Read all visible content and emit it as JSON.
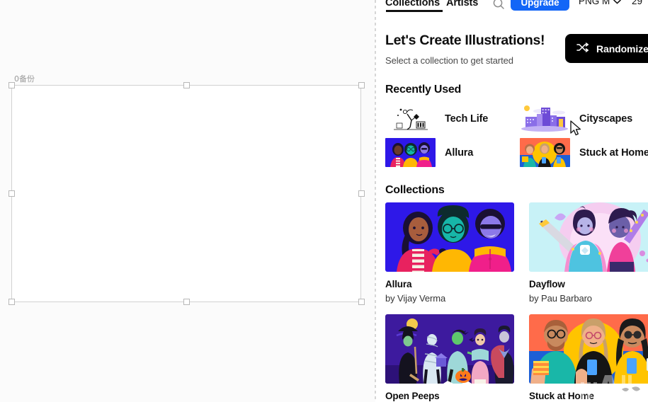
{
  "canvas": {
    "artboard_label": "0备份",
    "background_color": "#fbfbfb",
    "selection_border_color": "#d2d2d2"
  },
  "panel": {
    "tabs": [
      {
        "label": "Collections",
        "active": true
      },
      {
        "label": "Artists",
        "active": false
      }
    ],
    "search_icon": "search-icon",
    "upgrade_label": "Upgrade",
    "upgrade_color": "#1366f7",
    "format_value": "PNG M",
    "format_chevron": "chevron-down-icon",
    "credits_count": "29",
    "hero": {
      "title": "Let's Create Illustrations!",
      "subtitle": "Select a collection to get started",
      "randomize_label": "Randomize",
      "randomize_icon": "shuffle-icon",
      "randomize_color": "#000000"
    },
    "recently_used": {
      "heading": "Recently Used",
      "items": [
        {
          "label": "Tech Life",
          "thumb": "tech-life"
        },
        {
          "label": "Cityscapes",
          "thumb": "cityscapes"
        },
        {
          "label": "Allura",
          "thumb": "allura"
        },
        {
          "label": "Stuck at Home",
          "thumb": "stuck-at-home"
        }
      ]
    },
    "collections": {
      "heading": "Collections",
      "items": [
        {
          "title": "Allura",
          "author": "by Vijay Verma",
          "thumb": "allura"
        },
        {
          "title": "Dayflow",
          "author": "by Pau Barbaro",
          "thumb": "dayflow"
        },
        {
          "title": "Open Peeps",
          "author": "",
          "thumb": "open-peeps"
        },
        {
          "title": "Stuck at Home",
          "author": "",
          "thumb": "stuck-at-home"
        }
      ]
    }
  }
}
